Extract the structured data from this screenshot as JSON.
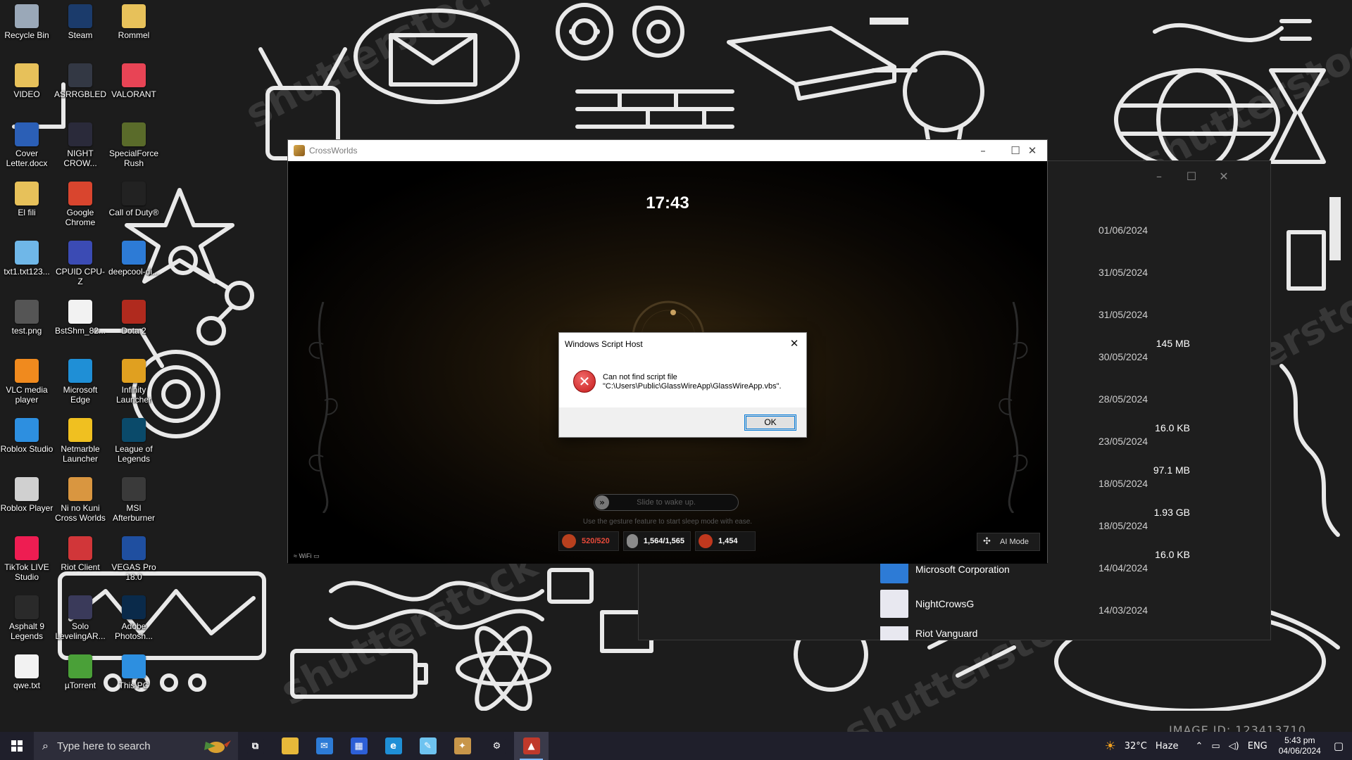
{
  "wallpaper": {
    "watermark": "shutterstock",
    "image_id": "IMAGE ID: 123413710"
  },
  "desktop_icons": [
    {
      "label": "Recycle Bin",
      "icon": "recycle-bin-icon",
      "color": "#9aa8b8"
    },
    {
      "label": "Steam",
      "icon": "steam-icon",
      "color": "#1b3b6b"
    },
    {
      "label": "Rommel",
      "icon": "folder-icon",
      "color": "#e7c15a"
    },
    {
      "label": "VIDEO",
      "icon": "folder-icon",
      "color": "#e7c15a"
    },
    {
      "label": "ASRRGBLED",
      "icon": "asrock-icon",
      "color": "#333844"
    },
    {
      "label": "VALORANT",
      "icon": "valorant-icon",
      "color": "#e84455"
    },
    {
      "label": "Cover Letter.docx",
      "icon": "word-document-icon",
      "color": "#2b5fb6"
    },
    {
      "label": "NIGHT CROW...",
      "icon": "night-crows-icon",
      "color": "#2a2a3a"
    },
    {
      "label": "SpecialForce Rush",
      "icon": "specialforce-icon",
      "color": "#5a6b2a"
    },
    {
      "label": "El fili",
      "icon": "folder-icon",
      "color": "#e7c15a"
    },
    {
      "label": "Google Chrome",
      "icon": "chrome-icon",
      "color": "#d9452e"
    },
    {
      "label": "Call of Duty®",
      "icon": "call-of-duty-icon",
      "color": "#222"
    },
    {
      "label": "txt1.txt123...",
      "icon": "file-icon",
      "color": "#6fb7e8"
    },
    {
      "label": "CPUID CPU-Z",
      "icon": "cpuz-icon",
      "color": "#3b4bb4"
    },
    {
      "label": "deepcool-di...",
      "icon": "deepcool-icon",
      "color": "#2d7bd6"
    },
    {
      "label": "test.png",
      "icon": "image-file-icon",
      "color": "#555"
    },
    {
      "label": "BstShm_82...",
      "icon": "blank-file-icon",
      "color": "#f2f2f2"
    },
    {
      "label": "Dota 2",
      "icon": "dota-icon",
      "color": "#b02a1e"
    },
    {
      "label": "VLC media player",
      "icon": "vlc-icon",
      "color": "#f08a1e"
    },
    {
      "label": "Microsoft Edge",
      "icon": "edge-icon",
      "color": "#1f8fd6"
    },
    {
      "label": "Infinity Launcher",
      "icon": "infinity-launcher-icon",
      "color": "#e0a020"
    },
    {
      "label": "Roblox Studio",
      "icon": "roblox-studio-icon",
      "color": "#2d8fe0"
    },
    {
      "label": "Netmarble Launcher",
      "icon": "netmarble-icon",
      "color": "#f0c020"
    },
    {
      "label": "League of Legends",
      "icon": "league-icon",
      "color": "#0a4a6a"
    },
    {
      "label": "Roblox Player",
      "icon": "roblox-player-icon",
      "color": "#d0d0d0"
    },
    {
      "label": "Ni no Kuni Cross Worlds",
      "icon": "ni-no-kuni-icon",
      "color": "#d99640"
    },
    {
      "label": "MSI Afterburner",
      "icon": "msi-afterburner-icon",
      "color": "#3a3a3a"
    },
    {
      "label": "TikTok LIVE Studio",
      "icon": "tiktok-icon",
      "color": "#ee1d52"
    },
    {
      "label": "Riot Client",
      "icon": "riot-client-icon",
      "color": "#d13639"
    },
    {
      "label": "VEGAS Pro 18.0",
      "icon": "vegas-pro-icon",
      "color": "#1f4fa0"
    },
    {
      "label": "Asphalt 9 Legends",
      "icon": "asphalt-icon",
      "color": "#2a2a2a"
    },
    {
      "label": "Solo LevelingAR...",
      "icon": "solo-leveling-icon",
      "color": "#3a3a5a"
    },
    {
      "label": "Adobe Photosh...",
      "icon": "photoshop-icon",
      "color": "#0a2a4a"
    },
    {
      "label": "qwe.txt",
      "icon": "text-file-icon",
      "color": "#f2f2f2"
    },
    {
      "label": "µTorrent",
      "icon": "utorrent-icon",
      "color": "#4aa038"
    },
    {
      "label": "This PC",
      "icon": "this-pc-icon",
      "color": "#2d8fe0"
    }
  ],
  "explorer": {
    "dates": [
      "01/06/2024",
      "31/05/2024",
      "31/05/2024",
      "30/05/2024",
      "28/05/2024",
      "23/05/2024",
      "18/05/2024",
      "18/05/2024",
      "14/04/2024",
      "14/03/2024"
    ],
    "sizes": [
      "145 MB",
      "16.0 KB",
      "97.1 MB",
      "1.93 GB",
      "16.0 KB"
    ],
    "publishers": [
      {
        "name": "Microsoft Corporation",
        "color": "#2d7bd6"
      },
      {
        "name": "NightCrowsG",
        "color": "#e8e8f0"
      },
      {
        "name": "Riot Vanguard",
        "color": "#e8e8f0"
      }
    ]
  },
  "crossworlds": {
    "title": "CrossWorlds",
    "clock": "17:43",
    "slide_text": "Slide to wake up.",
    "gesture_text": "Use the gesture feature to start sleep mode with ease.",
    "stats": [
      {
        "value": "520/520",
        "color": "#e84a3a",
        "icon": "stamina-icon"
      },
      {
        "value": "1,564/1,565",
        "color": "#ffffff",
        "icon": "storage-icon"
      },
      {
        "value": "1,454",
        "color": "#ffffff",
        "icon": "potion-icon"
      }
    ],
    "ai_mode": "AI Mode",
    "wifi": "WiFi"
  },
  "dialog": {
    "title": "Windows Script Host",
    "message_line1": "Can not find script file",
    "message_line2": "\"C:\\Users\\Public\\GlassWireApp\\GlassWireApp.vbs\".",
    "ok": "OK"
  },
  "taskbar": {
    "search_placeholder": "Type here to search",
    "pinned": [
      {
        "name": "task-view",
        "icon": "task-view-icon",
        "color": "#1f1f2b",
        "glyph": "⧉"
      },
      {
        "name": "file-explorer",
        "icon": "file-explorer-icon",
        "color": "#e7b83a",
        "glyph": ""
      },
      {
        "name": "mail",
        "icon": "mail-icon",
        "color": "#2d7bd6",
        "glyph": "✉"
      },
      {
        "name": "microsoft-store",
        "icon": "store-icon",
        "color": "#2d5fd6",
        "glyph": "▦"
      },
      {
        "name": "edge",
        "icon": "edge-icon",
        "color": "#1f8fd6",
        "glyph": "e"
      },
      {
        "name": "notepad-app",
        "icon": "notepad-icon",
        "color": "#6ec3f0",
        "glyph": "✎"
      },
      {
        "name": "crossworlds",
        "icon": "crossworlds-icon",
        "color": "#c8964a",
        "glyph": "✦"
      },
      {
        "name": "settings",
        "icon": "gear-icon",
        "color": "#1f1f2b",
        "glyph": "⚙"
      },
      {
        "name": "game-app",
        "icon": "game-app-icon",
        "color": "#c0392b",
        "glyph": "▲"
      }
    ],
    "weather_temp": "32°C",
    "weather_desc": "Haze",
    "language": "ENG",
    "time": "5:43 pm",
    "date": "04/06/2024"
  }
}
